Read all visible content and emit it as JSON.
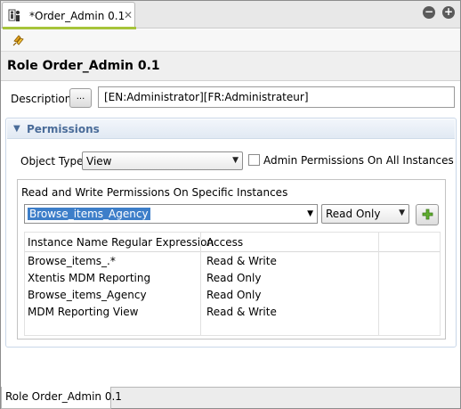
{
  "editor_tab": {
    "title": "*Order_Admin 0.1",
    "close": "✕"
  },
  "window_buttons": {
    "minimize": "−",
    "maximize": "+"
  },
  "header": {
    "title": "Role Order_Admin 0.1"
  },
  "description": {
    "label": "Description",
    "button": "...",
    "value": "[EN:Administrator][FR:Administrateur]"
  },
  "permissions": {
    "title": "Permissions",
    "object_type_label": "Object Type",
    "object_type_value": "View",
    "admin_checkbox_label": "Admin Permissions On All Instances",
    "admin_checkbox_checked": false,
    "group_title": "Read and Write Permissions On Specific Instances",
    "instance_value": "Browse_items_Agency",
    "access_value": "Read Only",
    "table": {
      "headers": [
        "Instance Name Regular Expression",
        "Access"
      ],
      "rows": [
        [
          "Browse_items_.*",
          "Read & Write"
        ],
        [
          "Xtentis MDM Reporting",
          "Read Only"
        ],
        [
          "Browse_items_Agency",
          "Read Only"
        ],
        [
          "MDM Reporting View",
          "Read & Write"
        ]
      ]
    }
  },
  "bottom_tab": {
    "title": "Role Order_Admin 0.1"
  },
  "colors": {
    "accent": "#a6c43a",
    "section_title": "#4a6c99",
    "selection": "#3d7ec9"
  }
}
